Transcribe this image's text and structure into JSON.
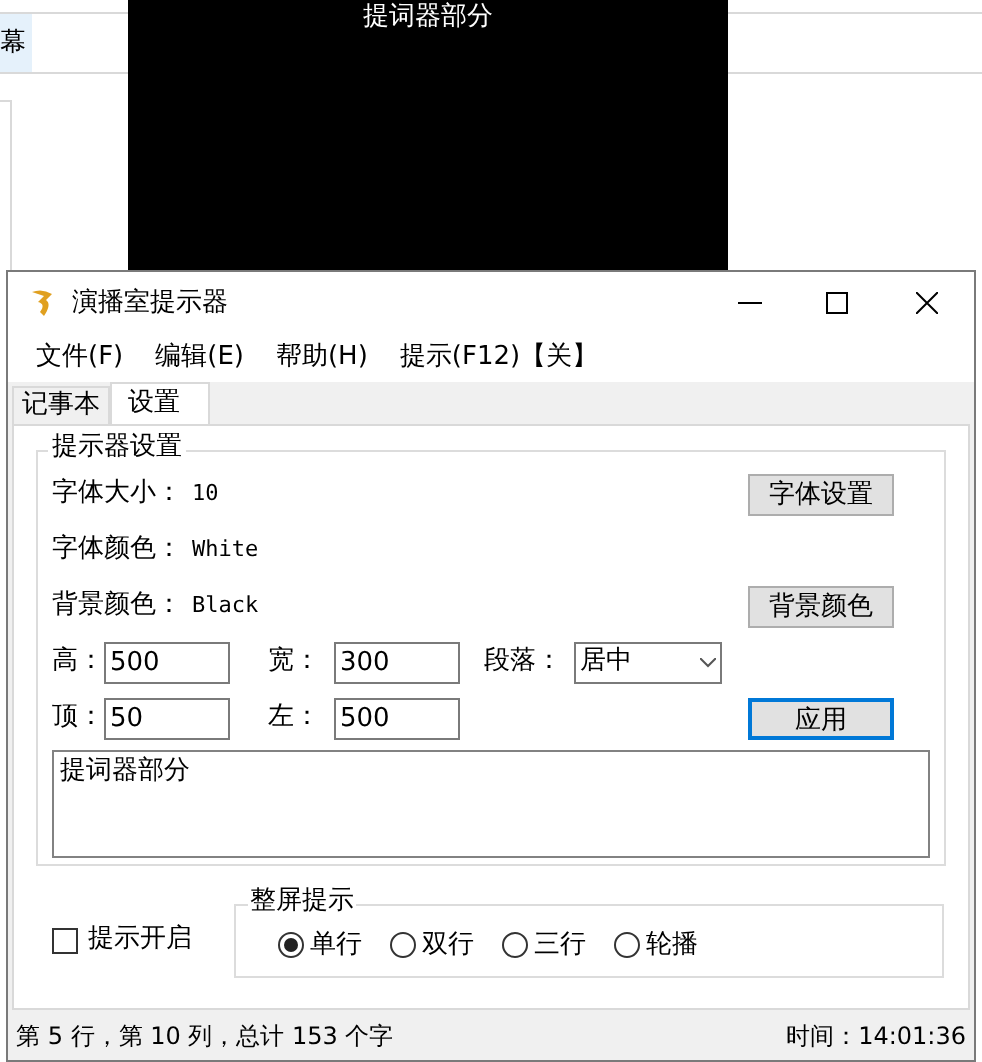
{
  "background": {
    "tab_label": "幕"
  },
  "teleprompter": {
    "text": "提词器部分"
  },
  "window": {
    "title": "演播室提示器"
  },
  "menu": [
    "文件(F)",
    "编辑(E)",
    "帮助(H)",
    "提示(F12)【关】"
  ],
  "tabs": [
    {
      "label": "记事本",
      "selected": false
    },
    {
      "label": "设置",
      "selected": true
    }
  ],
  "settings": {
    "title": "提示器设置",
    "font_size": {
      "label": "字体大小：",
      "value": "10",
      "button": "字体设置"
    },
    "font_color": {
      "label": "字体颜色：",
      "value": "White"
    },
    "bg_color": {
      "label": "背景颜色：",
      "value": "Black",
      "button": "背景颜色"
    },
    "height": {
      "label": "高：",
      "value": "500"
    },
    "width": {
      "label": "宽：",
      "value": "300"
    },
    "paragraph": {
      "label": "段落：",
      "value": "居中"
    },
    "top": {
      "label": "顶：",
      "value": "50"
    },
    "left": {
      "label": "左：",
      "value": "500"
    },
    "apply_button": "应用",
    "preview_text": "提词器部分"
  },
  "prompt_enabled": {
    "label": "提示开启",
    "checked": false
  },
  "fullscreen": {
    "title": "整屏提示",
    "options": [
      {
        "label": "单行",
        "selected": true
      },
      {
        "label": "双行",
        "selected": false
      },
      {
        "label": "三行",
        "selected": false
      },
      {
        "label": "轮播",
        "selected": false
      }
    ]
  },
  "status_bar": {
    "position": "第 5 行，第 10 列，总计 153 个字",
    "time": "时间：14:01:36"
  }
}
